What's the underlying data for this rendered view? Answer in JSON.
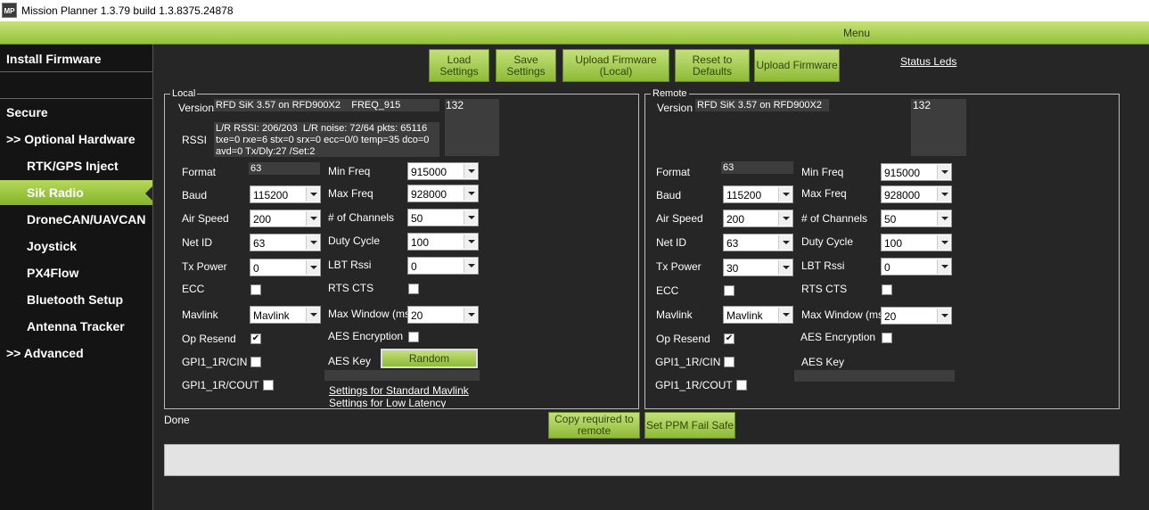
{
  "window": {
    "icon_text": "MP",
    "title": "Mission Planner 1.3.79 build 1.3.8375.24878"
  },
  "menubar": {
    "label": "Menu"
  },
  "sidebar": {
    "items": [
      {
        "label": "Install Firmware"
      },
      {
        "label": "Secure"
      },
      {
        "label": ">> Optional Hardware"
      },
      {
        "label": "RTK/GPS Inject"
      },
      {
        "label": "Sik Radio",
        "active": true
      },
      {
        "label": "DroneCAN/UAVCAN"
      },
      {
        "label": "Joystick"
      },
      {
        "label": "PX4Flow"
      },
      {
        "label": "Bluetooth Setup"
      },
      {
        "label": "Antenna Tracker"
      },
      {
        "label": ">> Advanced"
      }
    ]
  },
  "toolbar": {
    "load": "Load\nSettings",
    "save": "Save\nSettings",
    "upload_local": "Upload Firmware\n(Local)",
    "reset": "Reset to\nDefaults",
    "upload": "Upload Firmware",
    "status_leds": "Status Leds"
  },
  "local": {
    "title": "Local",
    "version_label": "Version",
    "version": "RFD SiK 3.57 on RFD900X2    FREQ_915",
    "version_num": "132",
    "rssi_label": "RSSI",
    "rssi": "L/R RSSI: 206/203  L/R noise: 72/64 pkts: 65116\ntxe=0 rxe=6 stx=0 srx=0 ecc=0/0 temp=35 dco=0\navd=0 Tx/Dly:27 /Set:2",
    "format_label": "Format",
    "format": "63",
    "baud_label": "Baud",
    "baud": "115200",
    "airspeed_label": "Air Speed",
    "airspeed": "200",
    "netid_label": "Net ID",
    "netid": "63",
    "txpower_label": "Tx Power",
    "txpower": "0",
    "ecc_label": "ECC",
    "mavlink_label": "Mavlink",
    "mavlink": "Mavlink",
    "opresend_label": "Op Resend",
    "gpi1_label": "GPI1_1R/CIN",
    "gpi1cout_label": "GPI1_1R/COUT",
    "minfreq_label": "Min Freq",
    "minfreq": "915000",
    "maxfreq_label": "Max Freq",
    "maxfreq": "928000",
    "channels_label": "# of Channels",
    "channels": "50",
    "duty_label": "Duty Cycle",
    "duty": "100",
    "lbt_label": "LBT Rssi",
    "lbt": "0",
    "rtscts_label": "RTS CTS",
    "maxwindow_label": "Max Window (ms)",
    "maxwindow": "20",
    "aesenc_label": "AES Encryption",
    "aeskey_label": "AES Key",
    "random": "Random",
    "std_link": "Settings for Standard Mavlink",
    "low_link": "Settings for Low Latency"
  },
  "remote": {
    "title": "Remote",
    "version_label": "Version",
    "version": "RFD SiK 3.57 on RFD900X2",
    "version_num": "132",
    "format_label": "Format",
    "format": "63",
    "baud_label": "Baud",
    "baud": "115200",
    "airspeed_label": "Air Speed",
    "airspeed": "200",
    "netid_label": "Net ID",
    "netid": "63",
    "txpower_label": "Tx Power",
    "txpower": "30",
    "ecc_label": "ECC",
    "mavlink_label": "Mavlink",
    "mavlink": "Mavlink",
    "opresend_label": "Op Resend",
    "gpi1_label": "GPI1_1R/CIN",
    "gpi1cout_label": "GPI1_1R/COUT",
    "minfreq_label": "Min Freq",
    "minfreq": "915000",
    "maxfreq_label": "Max Freq",
    "maxfreq": "928000",
    "channels_label": "# of Channels",
    "channels": "50",
    "duty_label": "Duty Cycle",
    "duty": "100",
    "lbt_label": "LBT Rssi",
    "lbt": "0",
    "rtscts_label": "RTS CTS",
    "maxwindow_label": "Max Window (ms)",
    "maxwindow": "20",
    "aesenc_label": "AES Encryption",
    "aeskey_label": "AES Key"
  },
  "bottom": {
    "status": "Done",
    "copy": "Copy required to\nremote",
    "ppm": "Set PPM Fail Safe"
  },
  "checkboxes": {
    "local_ecc": false,
    "local_opresend": true,
    "local_gpi1": false,
    "local_gpi1cout": false,
    "local_rtscts": false,
    "local_aesenc": false,
    "remote_ecc": false,
    "remote_opresend": true,
    "remote_gpi1": false,
    "remote_gpi1cout": false,
    "remote_rtscts": false,
    "remote_aesenc": false
  }
}
